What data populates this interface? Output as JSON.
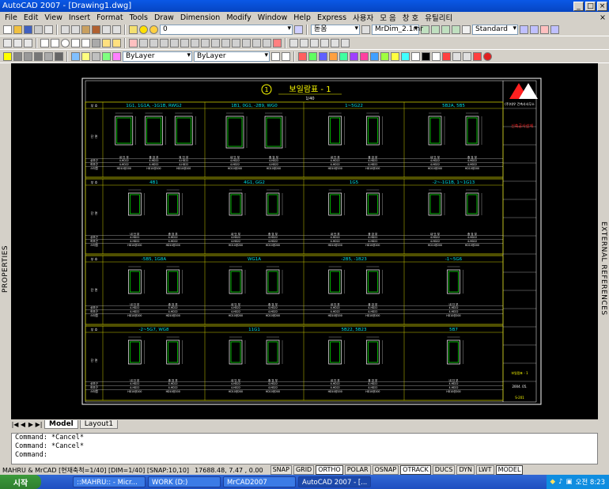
{
  "window": {
    "title": "AutoCAD 2007 - [Drawing1.dwg]"
  },
  "menu": [
    "File",
    "Edit",
    "View",
    "Insert",
    "Format",
    "Tools",
    "Draw",
    "Dimension",
    "Modify",
    "Window",
    "Help",
    "Express",
    "사용자",
    "모 음",
    "창 호",
    "유틸리티"
  ],
  "toolbar": {
    "layer_combo": "0",
    "text_style_combo": "돋움",
    "dim_style_combo": "MrDim_2.1mr",
    "table_style_combo": "Standard",
    "color_combo": "ByLayer",
    "linetype_combo": "ByLayer"
  },
  "side": {
    "left_label": "PROPERTIES",
    "right_label": "EXTERNAL REFERENCES"
  },
  "drawing": {
    "title": "보일람표 - 1",
    "title_num": "1",
    "scale": "1/40",
    "sections": [
      [
        "1G1, 1G1A, -1G1B, RWG2",
        "1B1, 0G1, -2B9, WG0",
        "1~5G22",
        "5B2A, 5B5"
      ],
      [
        "4B1",
        "4G1, GG2",
        "1G5",
        "-2~-1G1B, 1~1G13"
      ],
      [
        "-5B5, 1G8A",
        "WG1A",
        "-2B5, -1B23",
        "-1~5G6"
      ],
      [
        "-2~5G7, WG8",
        "11G1",
        "5B22, 5B23",
        "5B7"
      ]
    ],
    "row_labels": [
      "부 호",
      "단 면",
      "상부근",
      "하부근",
      "스터럽"
    ],
    "col_labels": [
      "내 단 부",
      "중 앙 부",
      "외 단 부"
    ],
    "rebar_text": "4-HD22",
    "stirrup_text": "HD10@200",
    "title_block": {
      "company": "(주)대우 건축사사무소",
      "project": "신축공사설계",
      "sheet_title": "보일람표 - 1",
      "date": "2004. 05.",
      "sheet_no": "S-201"
    }
  },
  "layout_tabs": [
    "Model",
    "Layout1"
  ],
  "command_lines": [
    "Command: *Cancel*",
    "Command: *Cancel*",
    "Command:"
  ],
  "status": {
    "app_info": "MAHRU & MrCAD [현재축척=1/40] [DIM=1/40] [SNAP:10,10]",
    "coords": "17688.48, 7.47 , 0.00",
    "toggles": [
      "SNAP",
      "GRID",
      "ORTHO",
      "POLAR",
      "OSNAP",
      "OTRACK",
      "DUCS",
      "DYN",
      "LWT",
      "MODEL"
    ],
    "toggles_on": [
      "ORTHO",
      "OTRACK",
      "MODEL"
    ]
  },
  "taskbar": {
    "start": "시작",
    "tasks": [
      "::MAHRU:: - Micr...",
      "WORK (D:)",
      "MrCAD2007",
      "AutoCAD 2007 - [..."
    ],
    "active_task": "AutoCAD 2007 - [...",
    "clock": "오전 8:23"
  },
  "colors": {
    "drawing_line": "#ffffff",
    "frame_yellow": "#c8c800",
    "rebar_green": "#00ff00",
    "text_cyan": "#00e0e0",
    "title_fill": "#ffff00",
    "accent_red": "#ff2020",
    "taskbar_blue": "#2458d0"
  }
}
